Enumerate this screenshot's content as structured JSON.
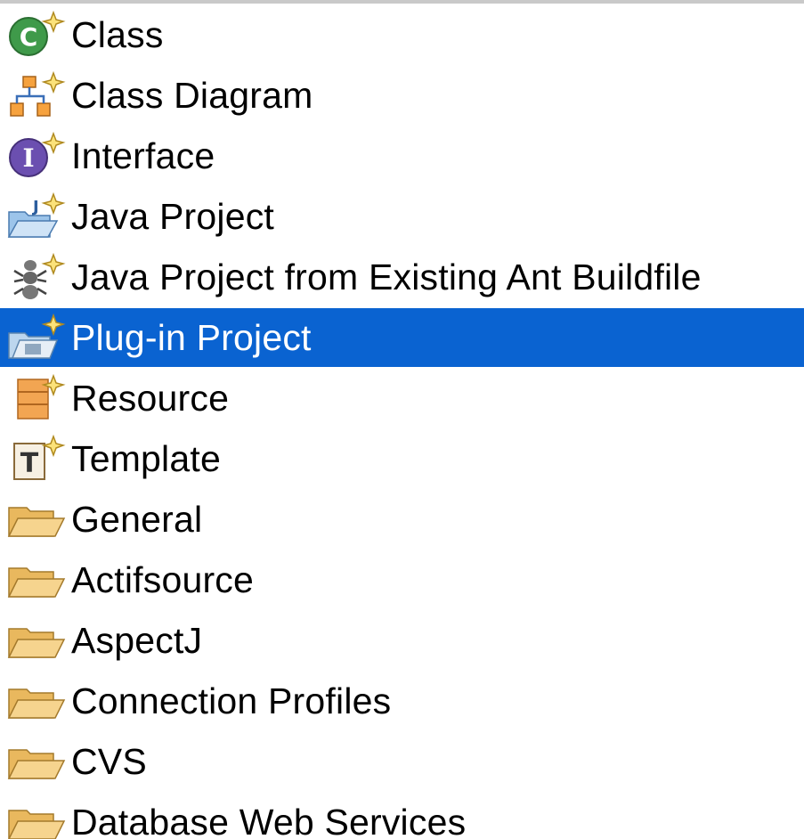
{
  "items": [
    {
      "label": "Class",
      "icon": "class-icon",
      "selected": false
    },
    {
      "label": "Class Diagram",
      "icon": "class-diagram-icon",
      "selected": false
    },
    {
      "label": "Interface",
      "icon": "interface-icon",
      "selected": false
    },
    {
      "label": "Java Project",
      "icon": "java-project-icon",
      "selected": false
    },
    {
      "label": "Java Project from Existing Ant Buildfile",
      "icon": "ant-buildfile-icon",
      "selected": false
    },
    {
      "label": "Plug-in Project",
      "icon": "plugin-project-icon",
      "selected": true
    },
    {
      "label": "Resource",
      "icon": "resource-icon",
      "selected": false
    },
    {
      "label": "Template",
      "icon": "template-icon",
      "selected": false
    },
    {
      "label": "General",
      "icon": "folder-icon",
      "selected": false
    },
    {
      "label": "Actifsource",
      "icon": "folder-icon",
      "selected": false
    },
    {
      "label": "AspectJ",
      "icon": "folder-icon",
      "selected": false
    },
    {
      "label": "Connection Profiles",
      "icon": "folder-icon",
      "selected": false
    },
    {
      "label": "CVS",
      "icon": "folder-icon",
      "selected": false
    },
    {
      "label": "Database Web Services",
      "icon": "folder-icon",
      "selected": false
    }
  ],
  "colors": {
    "selection": "#0a63d1",
    "folder": "#f3c77a",
    "class_green": "#3f9a4a",
    "interface_purple": "#6b4fb0",
    "resource_orange": "#e8953a"
  }
}
